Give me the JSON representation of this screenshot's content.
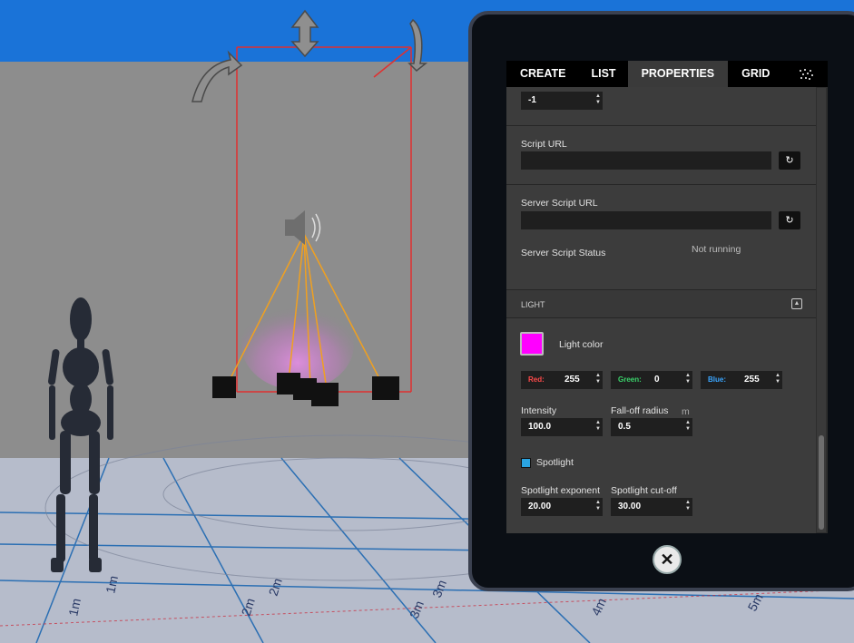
{
  "tabs": [
    {
      "label": "CREATE"
    },
    {
      "label": "LIST"
    },
    {
      "label": "PROPERTIES"
    },
    {
      "label": "GRID"
    }
  ],
  "active_tab": "PROPERTIES",
  "properties": {
    "top_field_value": "-1",
    "script_url_label": "Script URL",
    "script_url_value": "",
    "server_script_url_label": "Server Script URL",
    "server_script_url_value": "",
    "server_script_status_label": "Server Script Status",
    "server_script_status_value": "Not running",
    "light_section_label": "LIGHT",
    "light_color_label": "Light color",
    "light_color": "#ff00ff",
    "red_label": "Red:",
    "red_value": "255",
    "green_label": "Green:",
    "green_value": "0",
    "blue_label": "Blue:",
    "blue_value": "255",
    "intensity_label": "Intensity",
    "intensity_value": "100.0",
    "falloff_label": "Fall-off radius",
    "falloff_unit": "m",
    "falloff_value": "0.5",
    "spotlight_label": "Spotlight",
    "spotlight_checked": true,
    "spot_exponent_label": "Spotlight exponent",
    "spot_exponent_value": "20.00",
    "spot_cutoff_label": "Spotlight cut-off",
    "spot_cutoff_value": "30.00"
  },
  "floor_markers": [
    "1m",
    "1m",
    "2m",
    "2m",
    "3m",
    "3m",
    "4m",
    "5m"
  ],
  "colors": {
    "sky": "#1a73d8",
    "accent_red": "#ff3b3b",
    "accent_green": "#3bd36b",
    "accent_blue": "#3aa6ff",
    "selection_box": "#e03030",
    "light_glow": "#d878d8"
  }
}
